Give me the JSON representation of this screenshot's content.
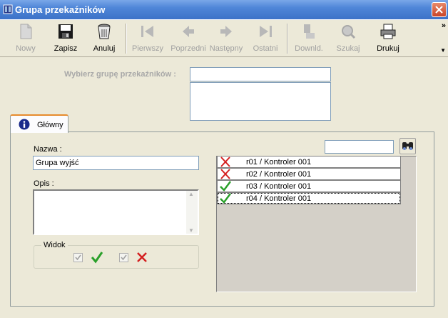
{
  "window": {
    "title": "Grupa przekaźników"
  },
  "toolbar": {
    "buttons": [
      {
        "label": "Nowy",
        "icon": "new-document-icon",
        "enabled": false
      },
      {
        "label": "Zapisz",
        "icon": "floppy-disk-icon",
        "enabled": true
      },
      {
        "label": "Anuluj",
        "icon": "trash-can-icon",
        "enabled": true
      },
      {
        "label": "Pierwszy",
        "icon": "first-record-icon",
        "enabled": false
      },
      {
        "label": "Poprzedni",
        "icon": "previous-record-icon",
        "enabled": false
      },
      {
        "label": "Następny",
        "icon": "next-record-icon",
        "enabled": false
      },
      {
        "label": "Ostatni",
        "icon": "last-record-icon",
        "enabled": false
      },
      {
        "label": "Downld.",
        "icon": "download-icon",
        "enabled": false
      },
      {
        "label": "Szukaj",
        "icon": "search-icon",
        "enabled": false
      },
      {
        "label": "Drukuj",
        "icon": "printer-icon",
        "enabled": true
      }
    ],
    "overflow": "»"
  },
  "group_select": {
    "label": "Wybierz grupę przekaźników :",
    "value": ""
  },
  "tabs": [
    {
      "label": "Główny",
      "active": true
    }
  ],
  "form": {
    "name_label": "Nazwa :",
    "name_value": "Grupa wyjść",
    "description_label": "Opis :",
    "description_value": "",
    "view_group": {
      "label": "Widok",
      "show_checked": true,
      "show_unchecked": true
    }
  },
  "relays": {
    "filter_value": "",
    "items": [
      {
        "status": "cross",
        "label": "r01 / Kontroler 001"
      },
      {
        "status": "cross",
        "label": "r02 / Kontroler 001"
      },
      {
        "status": "check",
        "label": "r03 / Kontroler 001"
      },
      {
        "status": "check",
        "label": "r04 / Kontroler 001"
      }
    ]
  },
  "colors": {
    "check": "#2aa02a",
    "cross": "#d42020",
    "titlebar": "#3c72c8"
  }
}
